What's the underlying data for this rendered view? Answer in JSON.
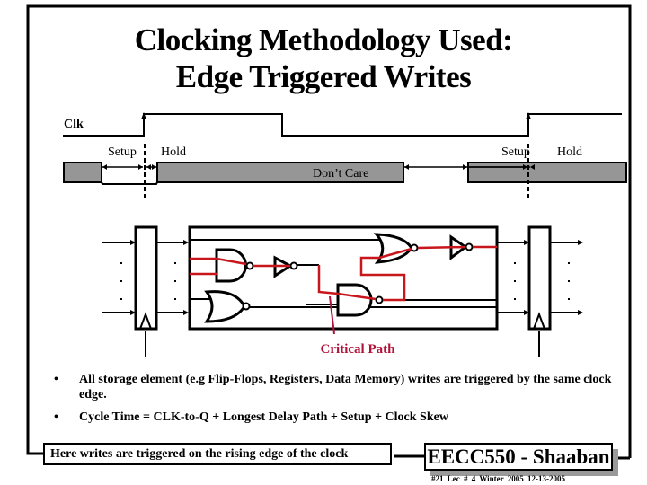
{
  "slide": {
    "title_line1": "Clocking Methodology Used:",
    "title_line2": "Edge Triggered Writes"
  },
  "timing_diagram": {
    "clock_label": "Clk",
    "setup_label": "Setup",
    "hold_label": "Hold",
    "dont_care_label": "Don’t Care",
    "dont_care_color": "#969696"
  },
  "circuit": {
    "critical_path_label": "Critical Path",
    "critical_path_color": "#c8161d",
    "critical_label_color": "#b0123a",
    "ellipsis": "·"
  },
  "bullets": [
    {
      "marker": "•",
      "text": "All storage element (e.g Flip-Flops, Registers, Data Memory)  writes are triggered  by the same clock edge."
    },
    {
      "marker": "•",
      "text": "Cycle Time = CLK-to-Q + Longest Delay Path + Setup + Clock Skew"
    }
  ],
  "footer": {
    "note": "Here writes are triggered on the rising edge of the clock",
    "course_label": "EECC550 - Shaaban",
    "meta": "#21   Lec # 4   Winter 2005   12-13-2005"
  }
}
